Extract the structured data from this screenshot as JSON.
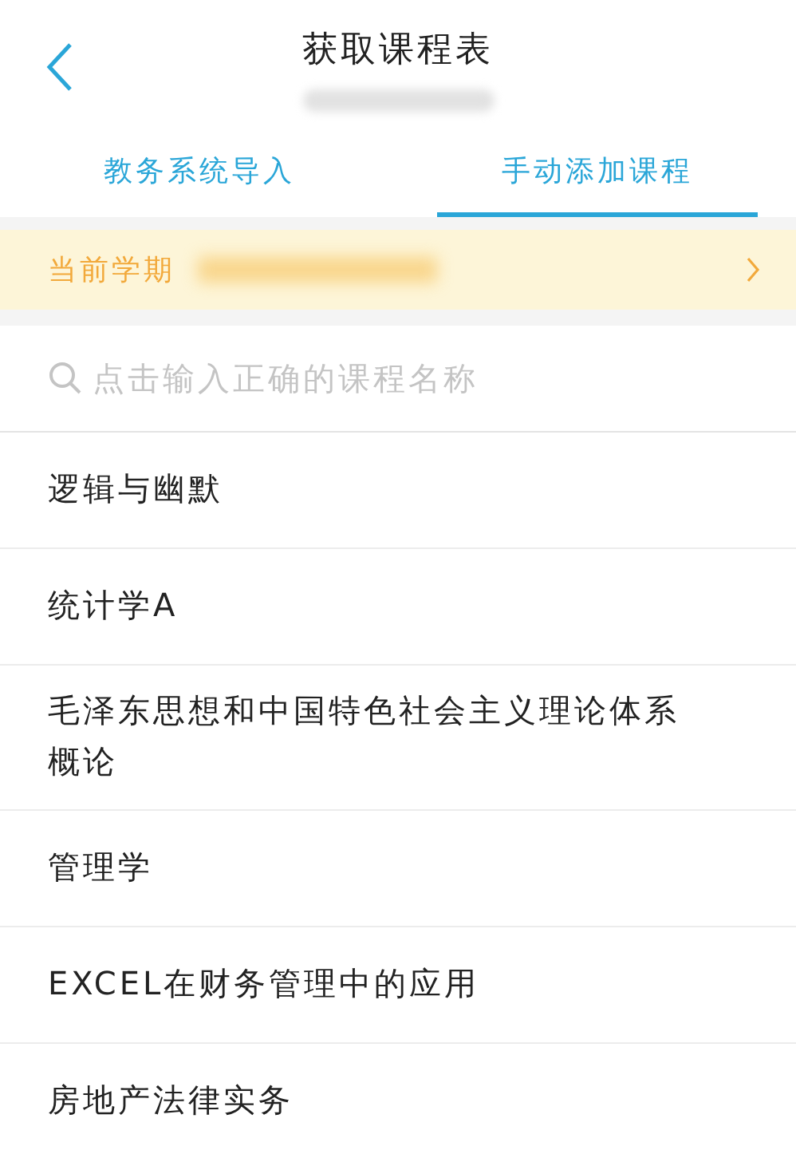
{
  "header": {
    "title": "获取课程表"
  },
  "tabs": [
    {
      "label": "教务系统导入",
      "selected": false
    },
    {
      "label": "手动添加课程",
      "selected": true
    }
  ],
  "semester": {
    "label": "当前学期"
  },
  "search": {
    "placeholder": "点击输入正确的课程名称"
  },
  "courses": [
    {
      "name": "逻辑与幽默"
    },
    {
      "name": "统计学A"
    },
    {
      "name": "毛泽东思想和中国特色社会主义理论体系概论"
    },
    {
      "name": "管理学"
    },
    {
      "name": "EXCEL在财务管理中的应用"
    },
    {
      "name": "房地产法律实务"
    }
  ]
}
